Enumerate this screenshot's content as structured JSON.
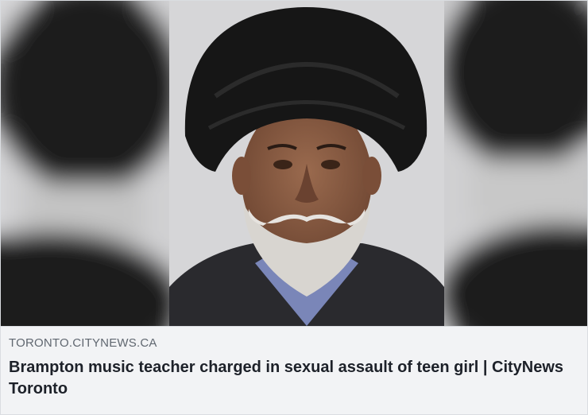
{
  "link_preview": {
    "domain": "TORONTO.CITYNEWS.CA",
    "title": "Brampton music teacher charged in sexual assault of teen girl | CityNews Toronto",
    "image": {
      "description_icon": "news-photo",
      "background_color": "#cfcfd1",
      "turban_color": "#161616",
      "skin_color": "#8a5d44",
      "beard_color": "#d8d5d0",
      "jacket_color": "#2a2a2e",
      "shirt_color": "#7a86b8"
    }
  },
  "colors": {
    "caption_bg": "#f2f3f5",
    "domain_text": "#606770",
    "title_text": "#1d2129",
    "border": "#dadde1"
  }
}
